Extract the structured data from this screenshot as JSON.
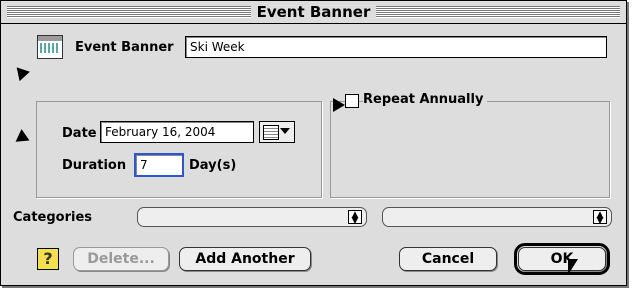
{
  "window": {
    "title": "Event Banner"
  },
  "event_banner": {
    "label": "Event Banner",
    "value": "Ski Week"
  },
  "repeat": {
    "label": "Repeat Annually",
    "checked": false
  },
  "date": {
    "label": "Date",
    "value": "February 16, 2004"
  },
  "duration": {
    "label": "Duration",
    "value": "7",
    "unit": "Day(s)"
  },
  "categories": {
    "label": "Categories",
    "value1": "",
    "value2": ""
  },
  "buttons": {
    "help": "?",
    "delete": "Delete...",
    "add_another": "Add Another",
    "cancel": "Cancel",
    "ok": "OK"
  }
}
